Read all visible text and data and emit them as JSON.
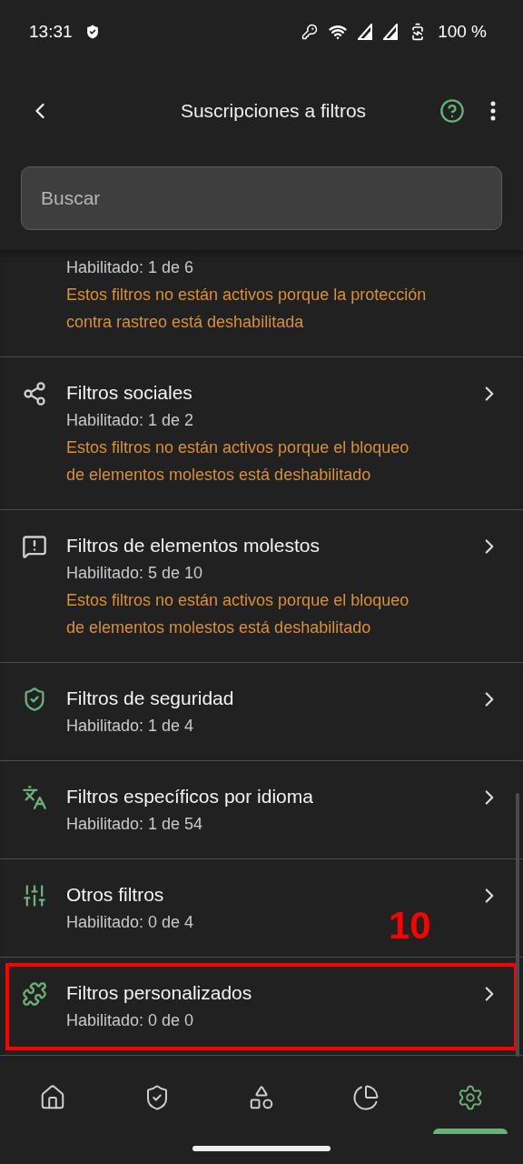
{
  "status_bar": {
    "time": "13:31",
    "battery": "100 %"
  },
  "app_bar": {
    "title": "Suscripciones a filtros"
  },
  "search": {
    "placeholder": "Buscar"
  },
  "items": [
    {
      "kind": "partial",
      "subtitle": "Habilitado: 1 de 6",
      "warning": "Estos filtros no están activos porque la protección contra rastreo está deshabilitada",
      "highlighted": false
    },
    {
      "kind": "social",
      "title": "Filtros sociales",
      "subtitle": "Habilitado: 1 de 2",
      "warning": "Estos filtros no están activos porque el bloqueo de elementos molestos está deshabilitado",
      "active": false,
      "highlighted": false
    },
    {
      "kind": "annoyances",
      "title": "Filtros de elementos molestos",
      "subtitle": "Habilitado: 5 de 10",
      "warning": "Estos filtros no están activos porque el bloqueo de elementos molestos está deshabilitado",
      "active": false,
      "highlighted": false
    },
    {
      "kind": "security",
      "title": "Filtros de seguridad",
      "subtitle": "Habilitado: 1 de 4",
      "active": true,
      "highlighted": false
    },
    {
      "kind": "language",
      "title": "Filtros específicos por idioma",
      "subtitle": "Habilitado: 1 de 54",
      "active": true,
      "highlighted": false
    },
    {
      "kind": "other",
      "title": "Otros filtros",
      "subtitle": "Habilitado: 0 de 4",
      "active": true,
      "highlighted": false
    },
    {
      "kind": "custom",
      "title": "Filtros personalizados",
      "subtitle": "Habilitado: 0 de 0",
      "active": true,
      "highlighted": true,
      "annotation": "10"
    }
  ],
  "nav": [
    {
      "kind": "home",
      "selected": false
    },
    {
      "kind": "protection",
      "selected": false
    },
    {
      "kind": "apps",
      "selected": false
    },
    {
      "kind": "stats",
      "selected": false
    },
    {
      "kind": "settings",
      "selected": true
    }
  ]
}
